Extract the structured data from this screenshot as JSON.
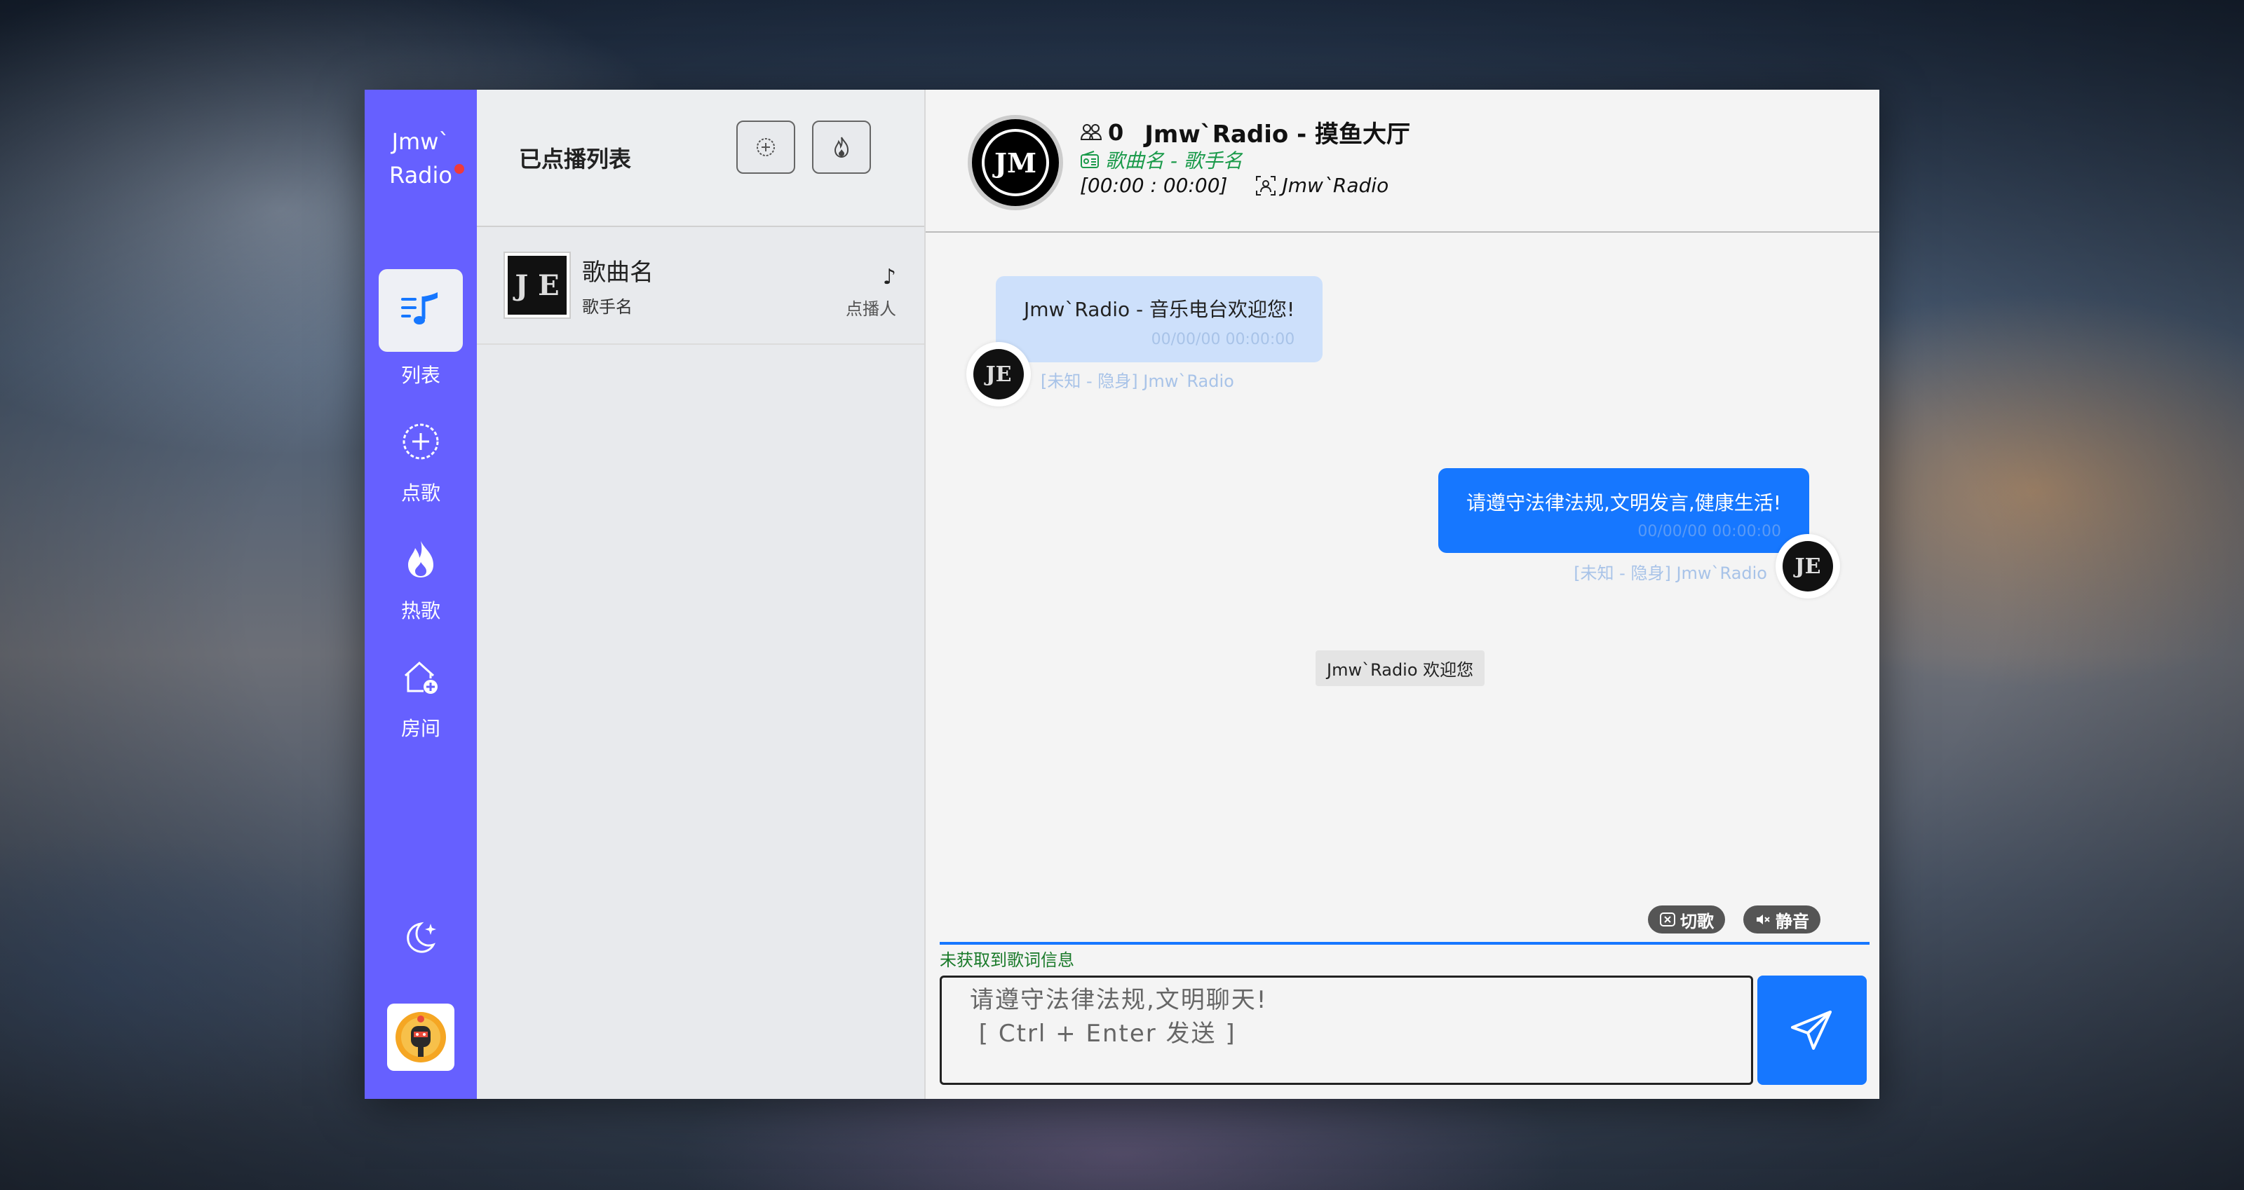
{
  "app": {
    "logo_line1": "Jmw`",
    "logo_line2": "Radio"
  },
  "sidebar": {
    "items": [
      {
        "label": "列表",
        "icon": "playlist-icon",
        "active": true
      },
      {
        "label": "点歌",
        "icon": "add-circle-icon",
        "active": false
      },
      {
        "label": "热歌",
        "icon": "fire-icon",
        "active": false
      },
      {
        "label": "房间",
        "icon": "room-add-icon",
        "active": false
      }
    ],
    "theme_icon": "moon-stars-icon",
    "user_avatar_icon": "user-avatar-icon"
  },
  "playlist": {
    "title": "已点播列表",
    "add_icon": "add-circle-icon",
    "hot_icon": "fire-icon",
    "songs": [
      {
        "name": "歌曲名",
        "artist": "歌手名",
        "cover_text": "J E",
        "note": "♪",
        "requester": "点播人"
      }
    ]
  },
  "room": {
    "online_count": "0",
    "name": "Jmw`Radio - 摸鱼大厅",
    "now_playing": "歌曲名 - 歌手名",
    "time": "[00:00 : 00:00]",
    "owner": "Jmw`Radio",
    "logo_text": "JM"
  },
  "messages": [
    {
      "text": "Jmw`Radio - 音乐电台欢迎您!",
      "time": "00/00/00 00:00:00",
      "sender": "[未知 - 隐身] Jmw`Radio"
    },
    {
      "text": "请遵守法律法规,文明发言,健康生活!",
      "time": "00/00/00 00:00:00",
      "sender": "[未知 - 隐身] Jmw`Radio"
    }
  ],
  "system_message": "Jmw`Radio 欢迎您",
  "controls": {
    "cut_label": "切歌",
    "mute_label": "静音"
  },
  "lyrics": "未获取到歌词信息",
  "input": {
    "placeholder": "请遵守法律法规,文明聊天!\n [ Ctrl + Enter 发送 ]"
  },
  "colors": {
    "sidebar": "#6660ff",
    "accent": "#1677ff",
    "green": "#1a9a4a"
  }
}
